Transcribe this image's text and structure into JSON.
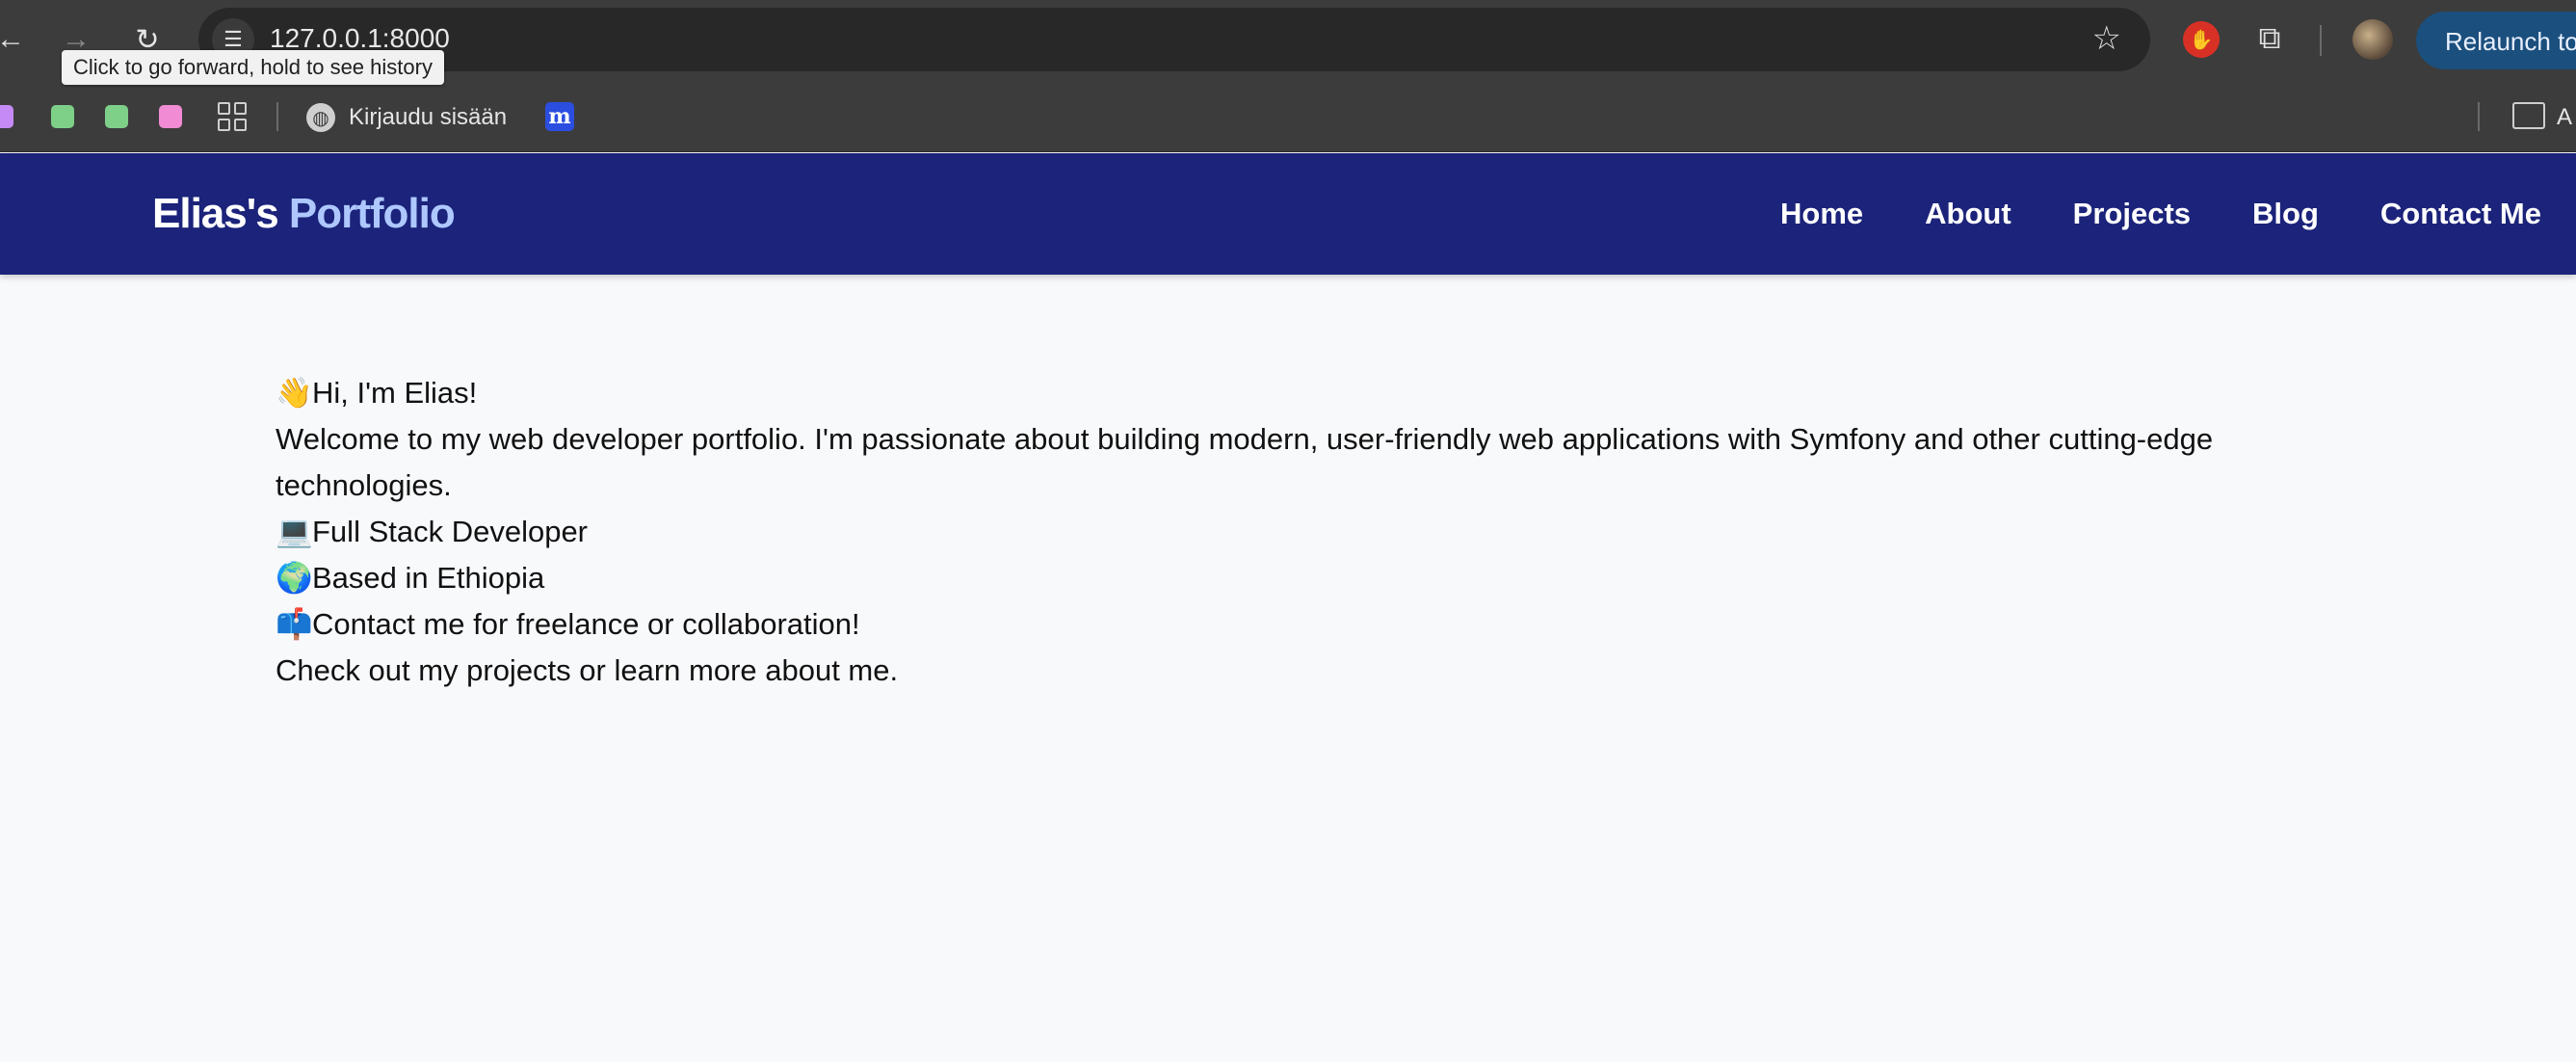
{
  "browser": {
    "url": "127.0.0.1:8000",
    "tooltip": "Click to go forward, hold to see history",
    "relaunch_label": "Relaunch to",
    "back_icon": "←",
    "forward_icon": "→",
    "reload_icon": "↻",
    "star_icon": "☆",
    "site_info_icon": "☰",
    "bookmarks": {
      "squares": [
        "#c58af5",
        "#7ed089",
        "#7ed089",
        "#f08bd4"
      ],
      "login_label": "Kirjaudu sisään",
      "m_label": "m",
      "folder_label": "A"
    }
  },
  "site": {
    "brand_name": "Elias's",
    "brand_accent": "Portfolio",
    "nav": [
      "Home",
      "About",
      "Projects",
      "Blog",
      "Contact Me"
    ],
    "colors": {
      "header_bg": "#1b237a",
      "brand_accent": "#aec8ff",
      "page_bg": "#f8f9fb"
    }
  },
  "content": {
    "greeting_emoji": "👋",
    "greeting": "Hi, I'm Elias!",
    "intro": "Welcome to my web developer portfolio. I'm passionate about building modern, user-friendly web applications with Symfony and other cutting-edge technologies.",
    "role_emoji": "💻",
    "role": "Full Stack Developer",
    "location_emoji": "🌍",
    "location": "Based in Ethiopia",
    "contact_emoji": "📫",
    "contact": "Contact me for freelance or collaboration!",
    "closing": "Check out my projects or learn more about me."
  }
}
